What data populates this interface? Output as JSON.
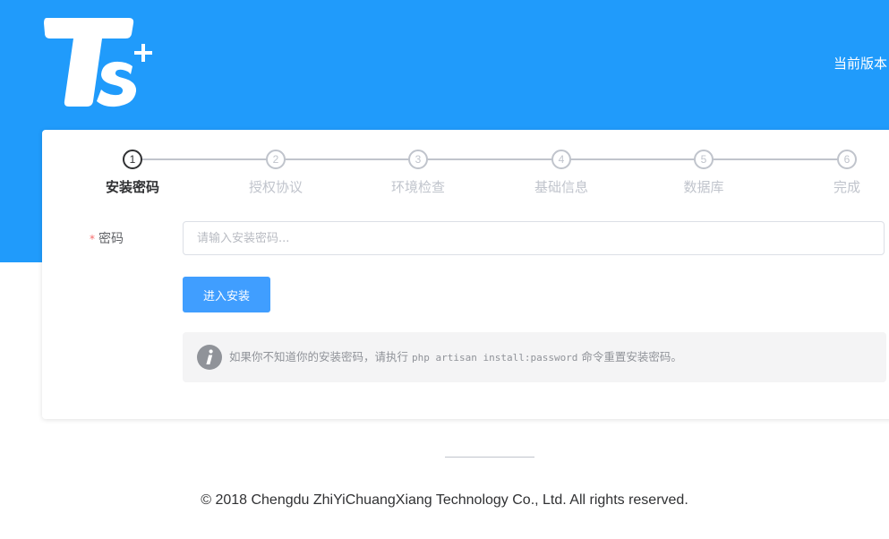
{
  "header": {
    "logo_text": "Ts+",
    "version_label": "当前版本"
  },
  "steps": [
    {
      "number": "1",
      "label": "安装密码",
      "active": true
    },
    {
      "number": "2",
      "label": "授权协议",
      "active": false
    },
    {
      "number": "3",
      "label": "环境检查",
      "active": false
    },
    {
      "number": "4",
      "label": "基础信息",
      "active": false
    },
    {
      "number": "5",
      "label": "数据库",
      "active": false
    },
    {
      "number": "6",
      "label": "完成",
      "active": false
    }
  ],
  "form": {
    "required_mark": "*",
    "password_label": "密码",
    "password_value": "",
    "password_placeholder": "请输入安装密码...",
    "submit_label": "进入安装"
  },
  "notice": {
    "icon": "info-icon",
    "text_before": "如果你不知道你的安装密码，请执行",
    "command": "php artisan install:password",
    "text_after": "命令重置安装密码。"
  },
  "footer": {
    "copyright": "© 2018 Chengdu ZhiYiChuangXiang Technology Co., Ltd. All rights reserved."
  },
  "colors": {
    "brand_blue": "#209bfb",
    "button_blue": "#409eff",
    "required_red": "#f56c6c",
    "active_step": "#303133",
    "inactive_step": "#c0c4cc"
  }
}
